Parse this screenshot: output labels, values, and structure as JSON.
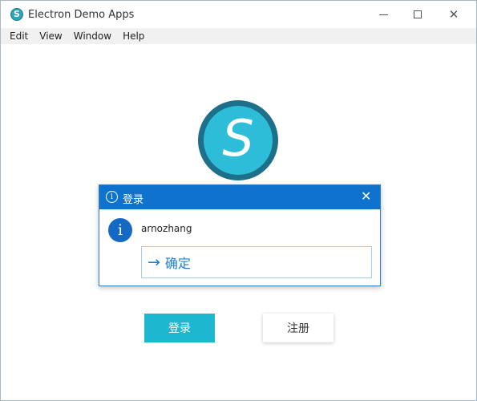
{
  "window": {
    "title": "Electron Demo Apps",
    "app_icon_glyph": "S",
    "controls": {
      "minimize": "minimize-icon",
      "maximize": "maximize-icon",
      "close": "close-icon"
    }
  },
  "menu": {
    "items": [
      {
        "label": "Edit"
      },
      {
        "label": "View"
      },
      {
        "label": "Window"
      },
      {
        "label": "Help"
      }
    ]
  },
  "main": {
    "logo_letter": "S",
    "login_label": "登录",
    "register_label": "注册"
  },
  "dialog": {
    "title": "登录",
    "message": "arnozhang",
    "confirm_label": "确定",
    "info_glyph": "i",
    "close_glyph": "✕",
    "arrow_glyph": "→"
  },
  "colors": {
    "dialog_header": "#0f73cd",
    "login_button": "#1db7cf",
    "logo_outer": "#1e6f8a",
    "logo_inner": "#2ebdd8",
    "accent_text": "#1f7fd1"
  }
}
